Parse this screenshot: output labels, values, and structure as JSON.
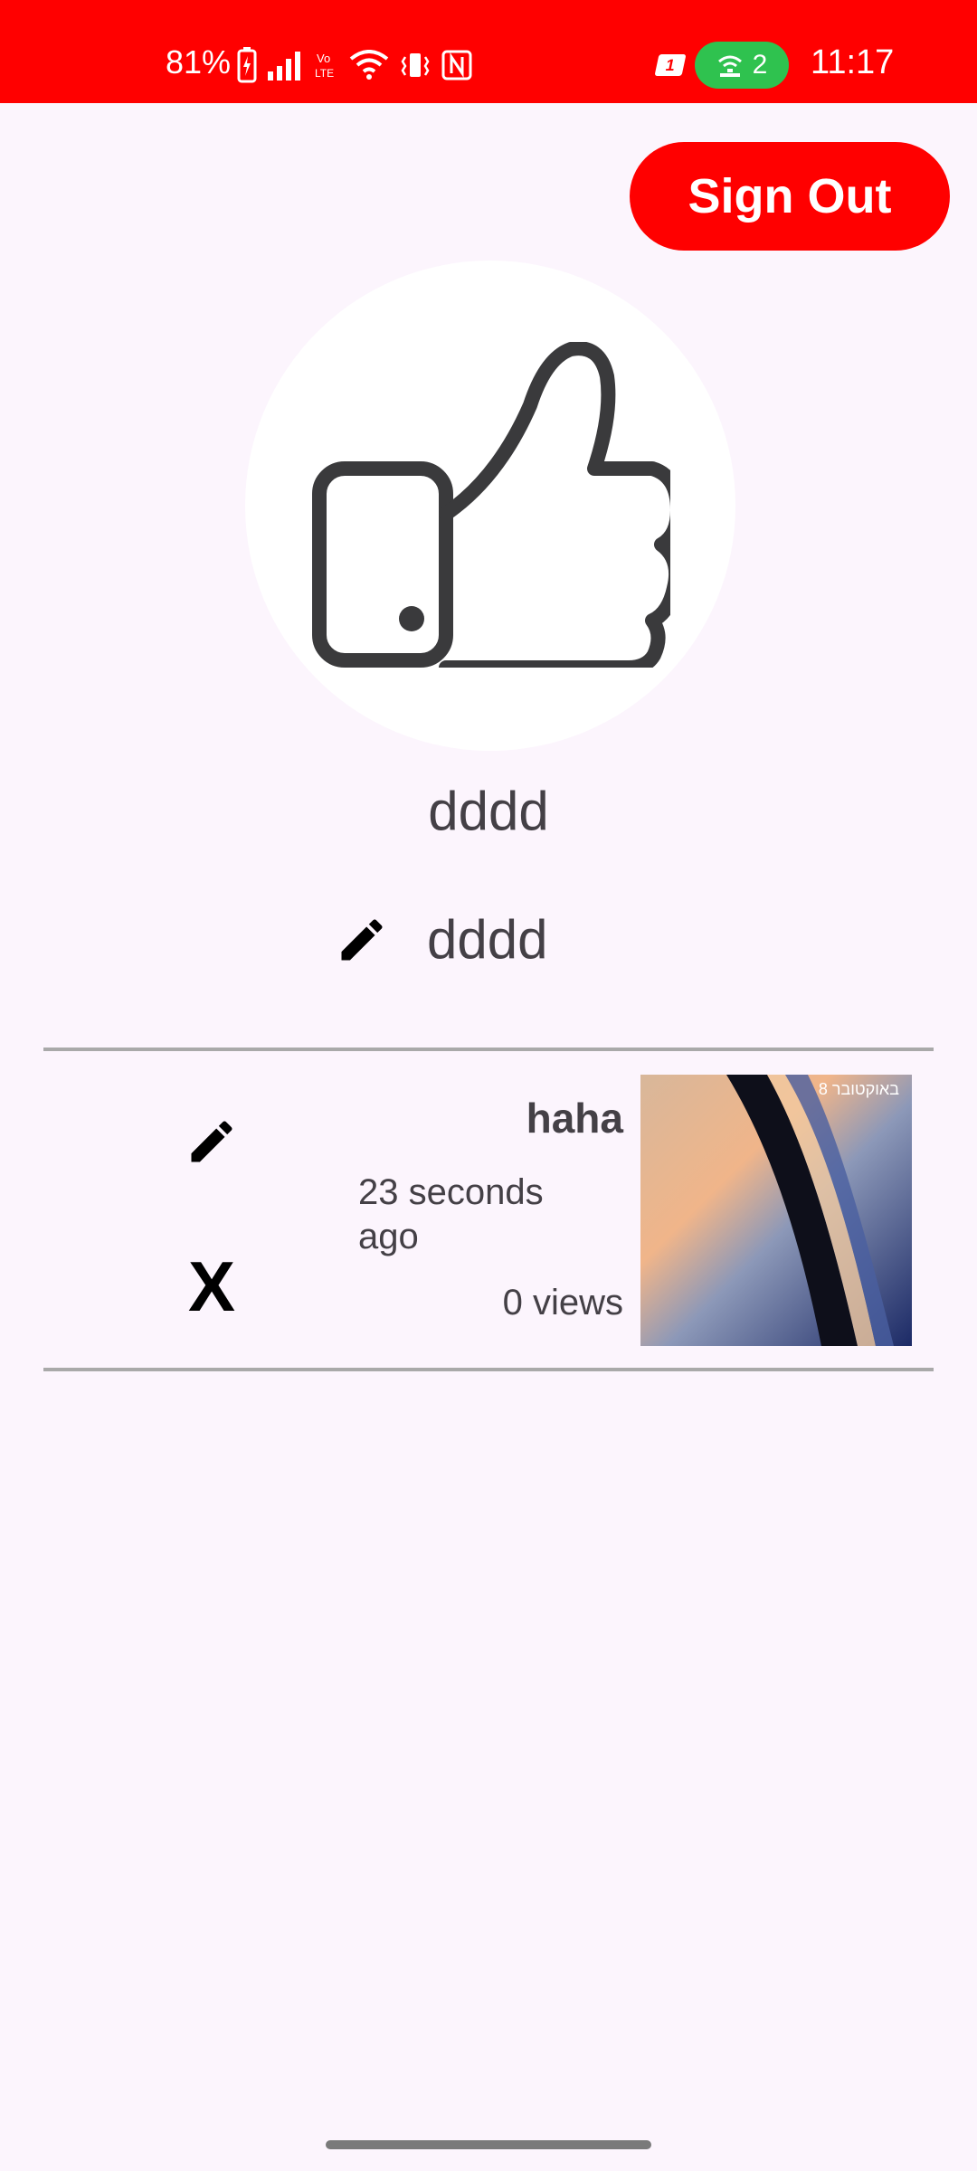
{
  "status_bar": {
    "battery": "81%",
    "hotspot_count": "2",
    "sim": "1",
    "time": "11:17"
  },
  "header": {
    "sign_out_label": "Sign Out"
  },
  "profile": {
    "avatar_icon": "thumbs-up-icon",
    "username": "dddd",
    "editable_name": "dddd"
  },
  "videos": [
    {
      "title": "haha",
      "time": "23 seconds ago",
      "views": "0 views",
      "thumb_label": "8 באוקטובר",
      "delete_label": "X"
    }
  ],
  "colors": {
    "accent": "#ff0000",
    "background": "#fcf5fd",
    "text": "#444046",
    "divider": "#a9a9a9"
  }
}
